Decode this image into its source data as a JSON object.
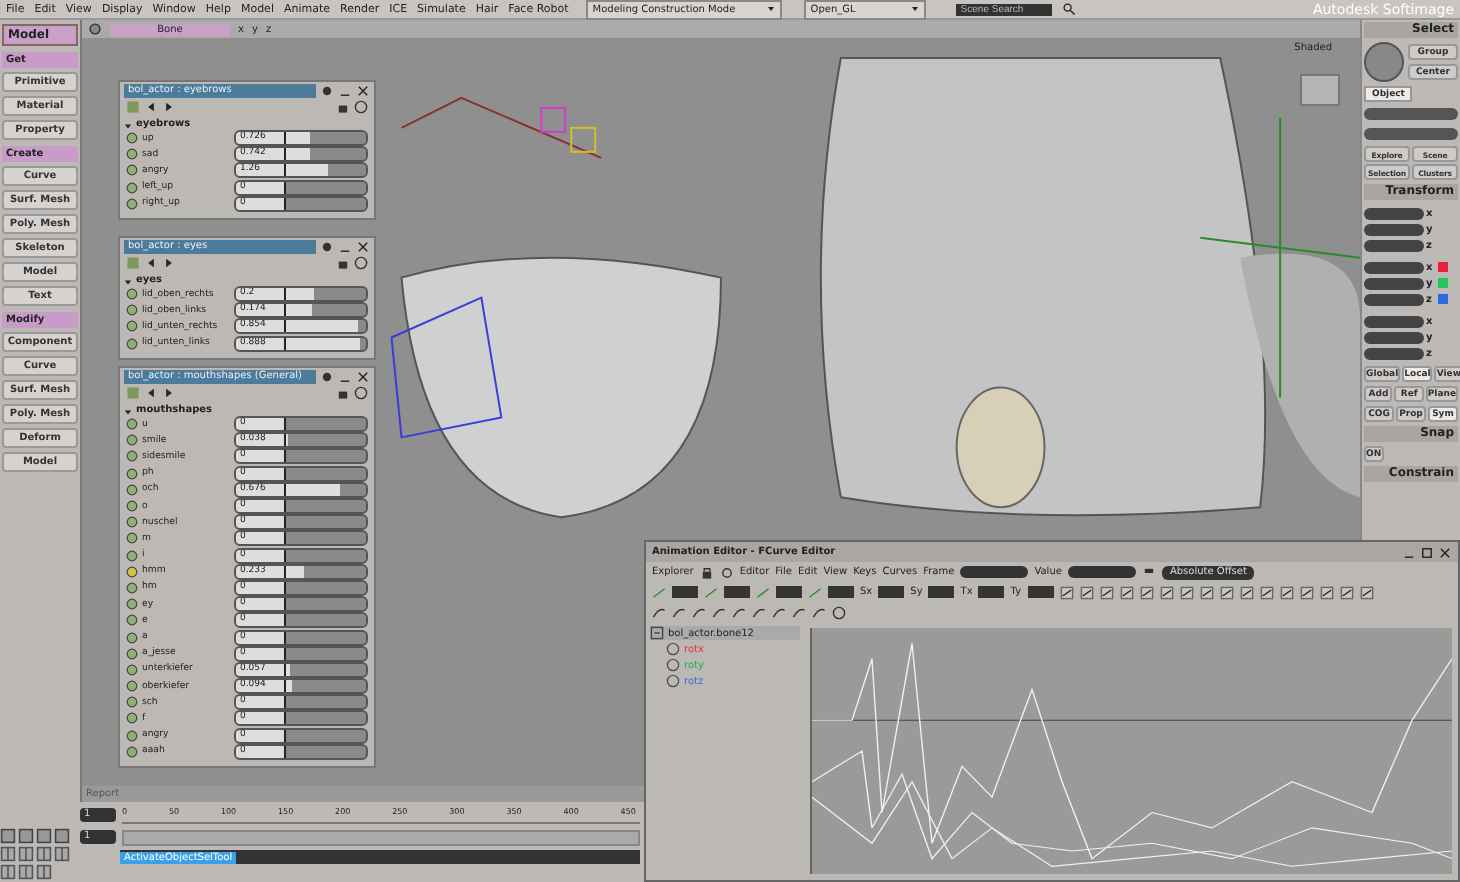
{
  "menubar": {
    "menus": [
      "File",
      "Edit",
      "View",
      "Display",
      "Window",
      "Help",
      "Model",
      "Animate",
      "Render",
      "ICE",
      "Simulate",
      "Hair",
      "Face Robot"
    ],
    "mode": "Modeling Construction Mode",
    "renderer": "Open_GL",
    "search_placeholder": "Scene Search",
    "app_title": "Autodesk Softimage"
  },
  "left_toolbar": {
    "module": "Model",
    "sections": [
      {
        "title": "Get",
        "buttons": [
          "Primitive",
          "Material",
          "Property"
        ]
      },
      {
        "title": "Create",
        "buttons": [
          "Curve",
          "Surf. Mesh",
          "Poly. Mesh",
          "Skeleton",
          "Model",
          "Text"
        ]
      },
      {
        "title": "Modify",
        "buttons": [
          "Component",
          "Curve",
          "Surf. Mesh",
          "Poly. Mesh",
          "Deform",
          "Model"
        ]
      }
    ]
  },
  "viewport": {
    "selection_filter": "Bone",
    "axes": [
      "x",
      "y",
      "z"
    ],
    "display_mode": "Shaded",
    "report": "Report"
  },
  "property_panels": [
    {
      "title": "bol_actor : eyebrows",
      "group": "eyebrows",
      "params": [
        {
          "name": "up",
          "value": "0.726",
          "level": 0.3,
          "keyed": false
        },
        {
          "name": "sad",
          "value": "0.742",
          "level": 0.3,
          "keyed": false
        },
        {
          "name": "angry",
          "value": "1.26",
          "level": 0.52,
          "keyed": false
        },
        {
          "name": "left_up",
          "value": "0",
          "level": 0,
          "keyed": false
        },
        {
          "name": "right_up",
          "value": "0",
          "level": 0,
          "keyed": false
        }
      ]
    },
    {
      "title": "bol_actor : eyes",
      "group": "eyes",
      "params": [
        {
          "name": "lid_oben_rechts",
          "value": "0.2",
          "level": 0.34,
          "keyed": false
        },
        {
          "name": "lid_oben_links",
          "value": "0.174",
          "level": 0.32,
          "keyed": false
        },
        {
          "name": "lid_unten_rechts",
          "value": "0.854",
          "level": 0.9,
          "keyed": false
        },
        {
          "name": "lid_unten_links",
          "value": "0.888",
          "level": 0.92,
          "keyed": false
        }
      ]
    },
    {
      "title": "bol_actor : mouthshapes (General)",
      "group": "mouthshapes",
      "params": [
        {
          "name": "u",
          "value": "0",
          "level": 0,
          "keyed": false
        },
        {
          "name": "smile",
          "value": "0.038",
          "level": 0.02,
          "keyed": false
        },
        {
          "name": "sidesmile",
          "value": "0",
          "level": 0,
          "keyed": false
        },
        {
          "name": "ph",
          "value": "0",
          "level": 0,
          "keyed": false
        },
        {
          "name": "och",
          "value": "0.676",
          "level": 0.68,
          "keyed": false
        },
        {
          "name": "o",
          "value": "0",
          "level": 0,
          "keyed": false
        },
        {
          "name": "nuschel",
          "value": "0",
          "level": 0,
          "keyed": false
        },
        {
          "name": "m",
          "value": "0",
          "level": 0,
          "keyed": false
        },
        {
          "name": "i",
          "value": "0",
          "level": 0,
          "keyed": false
        },
        {
          "name": "hmm",
          "value": "0.233",
          "level": 0.23,
          "keyed": true
        },
        {
          "name": "hm",
          "value": "0",
          "level": 0,
          "keyed": false
        },
        {
          "name": "ey",
          "value": "0",
          "level": 0,
          "keyed": false
        },
        {
          "name": "e",
          "value": "0",
          "level": 0,
          "keyed": false
        },
        {
          "name": "a",
          "value": "0",
          "level": 0,
          "keyed": false
        },
        {
          "name": "a_jesse",
          "value": "0",
          "level": 0,
          "keyed": false
        },
        {
          "name": "unterkiefer",
          "value": "0.057",
          "level": 0.05,
          "keyed": false
        },
        {
          "name": "oberkiefer",
          "value": "0.094",
          "level": 0.08,
          "keyed": false
        },
        {
          "name": "sch",
          "value": "0",
          "level": 0,
          "keyed": false
        },
        {
          "name": "f",
          "value": "0",
          "level": 0,
          "keyed": false
        },
        {
          "name": "angry",
          "value": "0",
          "level": 0,
          "keyed": false
        },
        {
          "name": "aaah",
          "value": "0",
          "level": 0,
          "keyed": false
        }
      ]
    }
  ],
  "right_panel": {
    "select_title": "Select",
    "select_buttons": [
      "Group",
      "Center"
    ],
    "tabs": [
      {
        "label": "Object",
        "selected": true
      }
    ],
    "explore_buttons": [
      "Explore",
      "Scene",
      "Selection",
      "Clusters"
    ],
    "transform_title": "Transform",
    "transform_groups": [
      {
        "axes": [
          {
            "label": "x"
          },
          {
            "label": "y"
          },
          {
            "label": "z"
          }
        ]
      },
      {
        "axes": [
          {
            "label": "x",
            "color": "#e8203a"
          },
          {
            "label": "y",
            "color": "#22c85a"
          },
          {
            "label": "z",
            "color": "#2a6ae0"
          }
        ]
      },
      {
        "axes": [
          {
            "label": "x"
          },
          {
            "label": "y"
          },
          {
            "label": "z"
          }
        ]
      }
    ],
    "space_buttons": [
      {
        "label": "Global",
        "selected": false
      },
      {
        "label": "Local",
        "selected": true
      },
      {
        "label": "View",
        "selected": false
      }
    ],
    "ref_buttons": [
      "Add",
      "Ref",
      "Plane"
    ],
    "pivot_buttons": [
      {
        "label": "COG",
        "selected": false
      },
      {
        "label": "Prop",
        "selected": false
      },
      {
        "label": "Sym",
        "selected": true
      }
    ],
    "snap_title": "Snap",
    "snap_on": "ON",
    "constrain_title": "Constrain"
  },
  "timeline": {
    "start": "1",
    "end": "1",
    "ticks": [
      "0",
      "50",
      "100",
      "150",
      "200",
      "250",
      "300",
      "350",
      "400",
      "450"
    ]
  },
  "command_line": "ActivateObjectSelTool",
  "animation_editor": {
    "title": "Animation Editor - FCurve Editor",
    "menus": [
      "Explorer",
      "Editor",
      "File",
      "Edit",
      "View",
      "Keys",
      "Curves"
    ],
    "frame_label": "Frame",
    "value_label": "Value",
    "offset_mode": "Absolute Offset",
    "scale_fields": [
      "Sx",
      "Sy",
      "Tx",
      "Ty"
    ],
    "tree": {
      "label": "bol_actor.bone12",
      "children": [
        {
          "label": "rotx",
          "color": "#e83040"
        },
        {
          "label": "roty",
          "color": "#22b050"
        },
        {
          "label": "rotz",
          "color": "#3070e0"
        }
      ]
    }
  }
}
